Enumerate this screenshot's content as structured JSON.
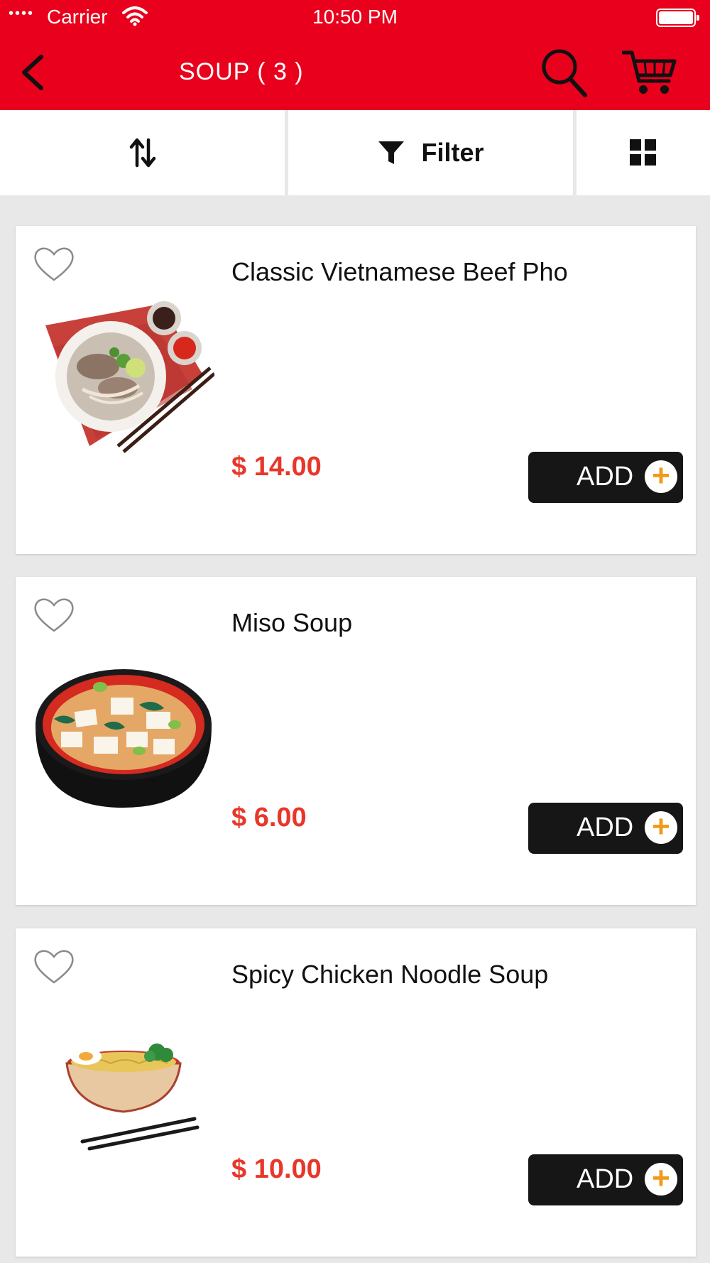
{
  "status_bar": {
    "dots": "••••",
    "carrier": "Carrier",
    "time": "10:50 PM"
  },
  "header": {
    "title": "SOUP ( 3 )"
  },
  "toolbar": {
    "filter_label": "Filter"
  },
  "colors": {
    "brand": "#e8001c",
    "price": "#e8372a",
    "add_button": "#161616",
    "add_plus": "#f29a1a"
  },
  "products": [
    {
      "name": "Classic Vietnamese Beef Pho",
      "price": "$ 14.00",
      "add_label": "ADD",
      "plus": "+"
    },
    {
      "name": "Miso Soup",
      "price": "$ 6.00",
      "add_label": "ADD",
      "plus": "+"
    },
    {
      "name": "Spicy Chicken Noodle Soup",
      "price": "$ 10.00",
      "add_label": "ADD",
      "plus": "+"
    }
  ]
}
